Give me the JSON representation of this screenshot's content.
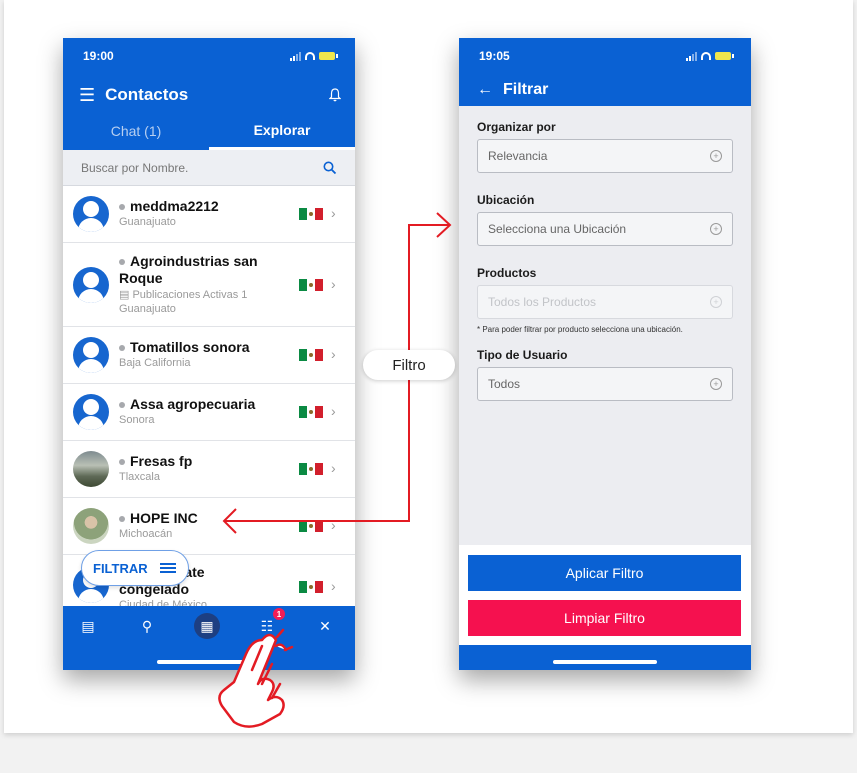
{
  "left_phone": {
    "status_time": "19:00",
    "title": "Contactos",
    "tabs": [
      "Chat (1)",
      "Explorar"
    ],
    "search_placeholder": "Buscar por Nombre.",
    "contacts": [
      {
        "name": "meddma2212",
        "sub": "Guanajuato"
      },
      {
        "name": "Agroindustrias san Roque",
        "publications": "Publicaciones Activas 1",
        "sub": "Guanajuato"
      },
      {
        "name": "Tomatillos sonora",
        "sub": "Baja California"
      },
      {
        "name": "Assa agropecuaria",
        "sub": "Sonora"
      },
      {
        "name": "Fresas fp",
        "sub": "Tlaxcala"
      },
      {
        "name": "HOPE INC",
        "sub": "Michoacán"
      },
      {
        "name": "d aguacate congelado",
        "name_prefix": "p",
        "sub": "Ciudad de México"
      }
    ],
    "filter_button": "FILTRAR",
    "nav_badge": "1"
  },
  "connector_label": "Filtro",
  "right_phone": {
    "status_time": "19:05",
    "title": "Filtrar",
    "fields": [
      {
        "label": "Organizar por",
        "value": "Relevancia"
      },
      {
        "label": "Ubicación",
        "value": "Selecciona una Ubicación"
      },
      {
        "label": "Productos",
        "value": "Todos los Productos",
        "hint": "* Para poder filtrar por producto selecciona una ubicación."
      },
      {
        "label": "Tipo de Usuario",
        "value": "Todos"
      }
    ],
    "apply_button": "Aplicar Filtro",
    "clear_button": "Limpiar Filtro"
  },
  "colors": {
    "primary": "#0a61d3",
    "danger": "#f5114f",
    "arrow": "#e31b23"
  }
}
